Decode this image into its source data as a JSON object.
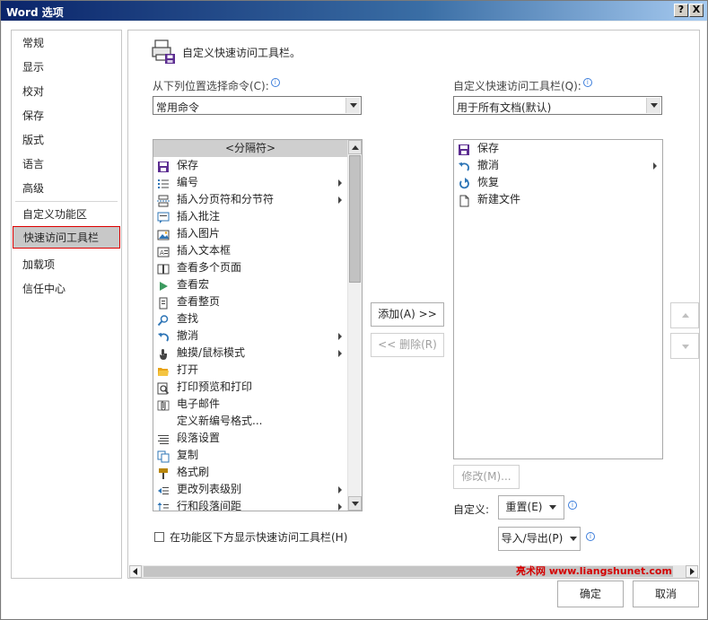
{
  "window": {
    "title": "Word 选项",
    "help_glyph": "?",
    "close_glyph": "X"
  },
  "nav": {
    "items": [
      "常规",
      "显示",
      "校对",
      "保存",
      "版式",
      "语言",
      "高级",
      "自定义功能区",
      "快速访问工具栏",
      "加载项",
      "信任中心"
    ],
    "selected": "快速访问工具栏"
  },
  "heading": "自定义快速访问工具栏。",
  "left": {
    "label": "从下列位置选择命令(C):",
    "combo_value": "常用命令",
    "items": [
      {
        "label": "<分隔符>",
        "icon": "separator",
        "color": "#555555"
      },
      {
        "label": "保存",
        "icon": "save-icon",
        "color": "#5c2d91"
      },
      {
        "label": "编号",
        "icon": "numbering-icon",
        "color": "#2e75b6",
        "sub": true
      },
      {
        "label": "插入分页符和分节符",
        "icon": "page-break-icon",
        "color": "#2e75b6",
        "sub": true
      },
      {
        "label": "插入批注",
        "icon": "comment-icon",
        "color": "#2e75b6"
      },
      {
        "label": "插入图片",
        "icon": "picture-icon",
        "color": "#2e75b6"
      },
      {
        "label": "插入文本框",
        "icon": "textbox-icon",
        "color": "#444444"
      },
      {
        "label": "查看多个页面",
        "icon": "multipage-icon",
        "color": "#444444"
      },
      {
        "label": "查看宏",
        "icon": "macro-icon",
        "color": "#3c9a5f"
      },
      {
        "label": "查看整页",
        "icon": "onepage-icon",
        "color": "#444444"
      },
      {
        "label": "查找",
        "icon": "find-icon",
        "color": "#2e75b6"
      },
      {
        "label": "撤消",
        "icon": "undo-icon",
        "color": "#2e75b6",
        "sub": true
      },
      {
        "label": "触摸/鼠标模式",
        "icon": "touch-icon",
        "color": "#444444",
        "sub": true
      },
      {
        "label": "打开",
        "icon": "open-folder-icon",
        "color": "#e8a317"
      },
      {
        "label": "打印预览和打印",
        "icon": "print-preview-icon",
        "color": "#444444"
      },
      {
        "label": "电子邮件",
        "icon": "email-icon",
        "color": "#444444"
      },
      {
        "label": "定义新编号格式...",
        "icon": "",
        "color": "#444444"
      },
      {
        "label": "段落设置",
        "icon": "paragraph-icon",
        "color": "#444444"
      },
      {
        "label": "复制",
        "icon": "copy-icon",
        "color": "#2e75b6"
      },
      {
        "label": "格式刷",
        "icon": "format-painter-icon",
        "color": "#b8860b"
      },
      {
        "label": "更改列表级别",
        "icon": "list-level-icon",
        "color": "#2e75b6",
        "sub": true
      },
      {
        "label": "行和段落间距",
        "icon": "line-spacing-icon",
        "color": "#2e75b6",
        "sub": true
      }
    ]
  },
  "right": {
    "label": "自定义快速访问工具栏(Q):",
    "combo_value": "用于所有文档(默认)",
    "items": [
      {
        "label": "保存",
        "icon": "save-icon",
        "color": "#5c2d91"
      },
      {
        "label": "撤消",
        "icon": "undo-icon",
        "color": "#2e75b6",
        "sub": true
      },
      {
        "label": "恢复",
        "icon": "redo-icon",
        "color": "#2e75b6"
      },
      {
        "label": "新建文件",
        "icon": "new-file-icon",
        "color": "#444444"
      }
    ]
  },
  "buttons": {
    "add": "添加(A) >>",
    "remove": "<< 删除(R)",
    "modify": "修改(M)...",
    "customize_label": "自定义:",
    "reset": "重置(E)",
    "import_export": "导入/导出(P)",
    "ok": "确定",
    "cancel": "取消"
  },
  "checkbox": {
    "label": "在功能区下方显示快速访问工具栏(H)",
    "checked": false
  },
  "watermark": "亮术网 www.liangshunet.com"
}
